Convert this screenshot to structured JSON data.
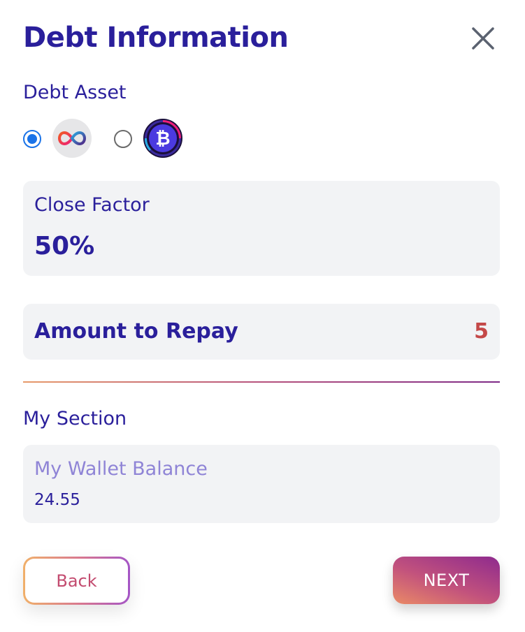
{
  "header": {
    "title": "Debt Information"
  },
  "debt_asset": {
    "label": "Debt Asset",
    "options": [
      {
        "icon": "icp-infinity-icon",
        "selected": true
      },
      {
        "icon": "bitcoin-icon",
        "selected": false
      }
    ]
  },
  "close_factor": {
    "label": "Close Factor",
    "value": "50%"
  },
  "repay": {
    "label": "Amount to Repay",
    "value": "5"
  },
  "my_section": {
    "label": "My Section",
    "wallet": {
      "label": "My Wallet Balance",
      "value": "24.55"
    }
  },
  "actions": {
    "back_label": "Back",
    "next_label": "NEXT"
  },
  "colors": {
    "primary_text": "#2a1f9b",
    "radio_accent": "#1a73e8",
    "repay_value": "#c44848",
    "card_bg": "#f2f3f5"
  }
}
